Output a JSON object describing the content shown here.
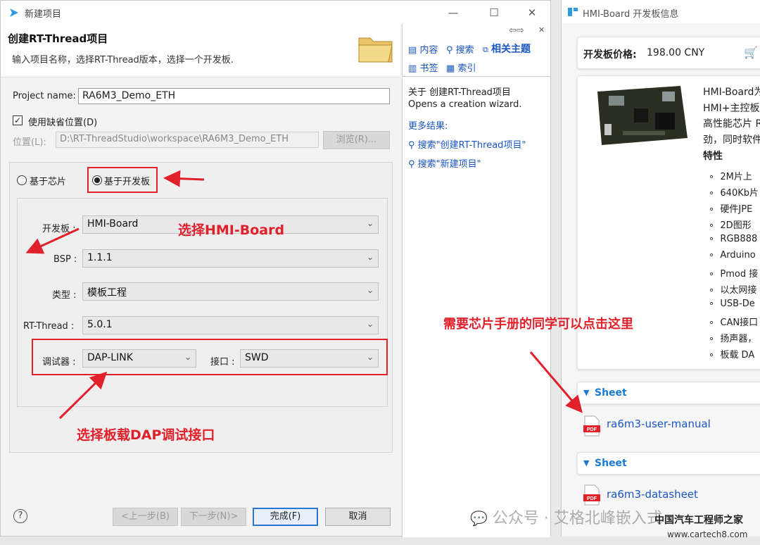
{
  "dialog": {
    "window_title": "新建项目",
    "banner_title": "创建RT-Thread项目",
    "banner_subtitle": "输入项目名称，选择RT-Thread版本，选择一个开发板.",
    "project_name_label": "Project name:",
    "project_name_value": "RA6M3_Demo_ETH",
    "use_default_location_label": "使用缺省位置(D)",
    "use_default_location_checked": true,
    "location_label": "位置(L):",
    "location_value": "D:\\RT-ThreadStudio\\workspace\\RA6M3_Demo_ETH",
    "browse_label": "浏览(R)...",
    "mode_chip_label": "基于芯片",
    "mode_board_label": "基于开发板",
    "board_label": "开发板 :",
    "board_value": "HMI-Board",
    "bsp_label": "BSP :",
    "bsp_value": "1.1.1",
    "type_label": "类型 :",
    "type_value": "模板工程",
    "rtthread_label": "RT-Thread :",
    "rtthread_value": "5.0.1",
    "debugger_label": "调试器 :",
    "debugger_value": "DAP-LINK",
    "interface_label": "接口 :",
    "interface_value": "SWD",
    "buttons": {
      "help": "?",
      "back": "<上一步(B)",
      "next": "下一步(N)>",
      "finish": "完成(F)",
      "cancel": "取消"
    }
  },
  "help_panel": {
    "tabs": [
      "内容",
      "搜索",
      "相关主题",
      "书签",
      "索引"
    ],
    "about_title": "关于 创建RT-Thread项目",
    "about_desc": "Opens a creation wizard.",
    "more_results": "更多结果:",
    "results": [
      "搜索\"创建RT-Thread项目\"",
      "搜索\"新建项目\""
    ]
  },
  "board_window": {
    "title": "HMI-Board 开发板信息",
    "price_label": "开发板价格:",
    "price_value": "198.00 CNY",
    "desc_lines": [
      "HMI-Board为",
      "HMI+主控板",
      "高性能芯片 R",
      "劲，同时软件"
    ],
    "features_title": "特性",
    "features": [
      "2M片上",
      "640Kb片",
      "硬件JPE",
      "2D图形",
      "RGB888",
      "Arduino",
      "Pmod 接",
      "以太网接",
      "USB-De",
      "CAN接口",
      "扬声器，",
      "板载 DA"
    ],
    "sections": [
      {
        "header": "Sheet",
        "file": "ra6m3-user-manual"
      },
      {
        "header": "Sheet",
        "file": "ra6m3-datasheet"
      }
    ]
  },
  "annotations": {
    "select_board": "选择HMI-Board",
    "chip_manual": "需要芯片手册的同学可以点击这里",
    "select_dap": "选择板载DAP调试接口"
  },
  "watermark": {
    "wechat": "公众号 · 艾格北峰嵌入式",
    "site_name": "中国汽车工程师之家",
    "site_url": "www.cartech8.com"
  },
  "colors": {
    "annotation_red": "#e0202a",
    "link_blue": "#1a55c4",
    "accent_blue": "#2b75d6"
  }
}
